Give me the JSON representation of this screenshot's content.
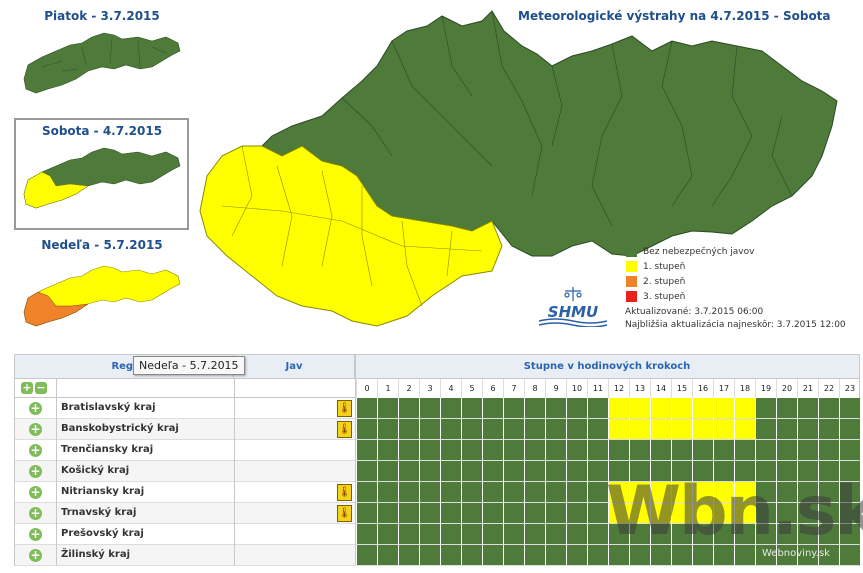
{
  "days": [
    {
      "label": "Piatok - 3.7.2015"
    },
    {
      "label": "Sobota - 4.7.2015"
    },
    {
      "label": "Nedeľa - 5.7.2015"
    }
  ],
  "main_title": "Meteorologické výstrahy na 4.7.2015 - Sobota",
  "legend": [
    {
      "label": "Bez nebezpečných javov",
      "color": "#4e7a3a"
    },
    {
      "label": "1. stupeň",
      "color": "#ffff00"
    },
    {
      "label": "2. stupeň",
      "color": "#f0822a"
    },
    {
      "label": "3. stupeň",
      "color": "#e4231d"
    }
  ],
  "logo_text": "SHMU",
  "update": {
    "updated": "Aktualizované:  3.7.2015 06:00",
    "next": "Najbližšia aktualizácia najneskôr: 3.7.2015 12:00"
  },
  "table": {
    "region_header": "Regi",
    "phenomenon_header": "Jav",
    "hours_header": "Stupne v hodinových krokoch",
    "hours": [
      "0",
      "1",
      "2",
      "3",
      "4",
      "5",
      "6",
      "7",
      "8",
      "9",
      "10",
      "11",
      "12",
      "13",
      "14",
      "15",
      "16",
      "17",
      "18",
      "19",
      "20",
      "21",
      "22",
      "23"
    ],
    "rows": [
      {
        "name": "Bratislavský kraj",
        "thermo": true,
        "yellow_from": 12,
        "yellow_to": 18
      },
      {
        "name": "Banskobystrický kraj",
        "thermo": true,
        "yellow_from": 12,
        "yellow_to": 18
      },
      {
        "name": "Trenčiansky kraj",
        "thermo": false,
        "yellow_from": null,
        "yellow_to": null
      },
      {
        "name": "Košický kraj",
        "thermo": false,
        "yellow_from": null,
        "yellow_to": null
      },
      {
        "name": "Nitriansky kraj",
        "thermo": true,
        "yellow_from": 12,
        "yellow_to": 18
      },
      {
        "name": "Trnavský kraj",
        "thermo": true,
        "yellow_from": 12,
        "yellow_to": 18
      },
      {
        "name": "Prešovský kraj",
        "thermo": false,
        "yellow_from": null,
        "yellow_to": null
      },
      {
        "name": "Žilinský kraj",
        "thermo": false,
        "yellow_from": null,
        "yellow_to": null
      }
    ]
  },
  "tooltip": "Nedeľa - 5.7.2015",
  "watermark": "Wbn.sk",
  "watermark_sub": "Webnoviny.sk",
  "colors": {
    "green": "#4e7a3a",
    "yellow": "#ffff00",
    "orange": "#f0822a"
  }
}
